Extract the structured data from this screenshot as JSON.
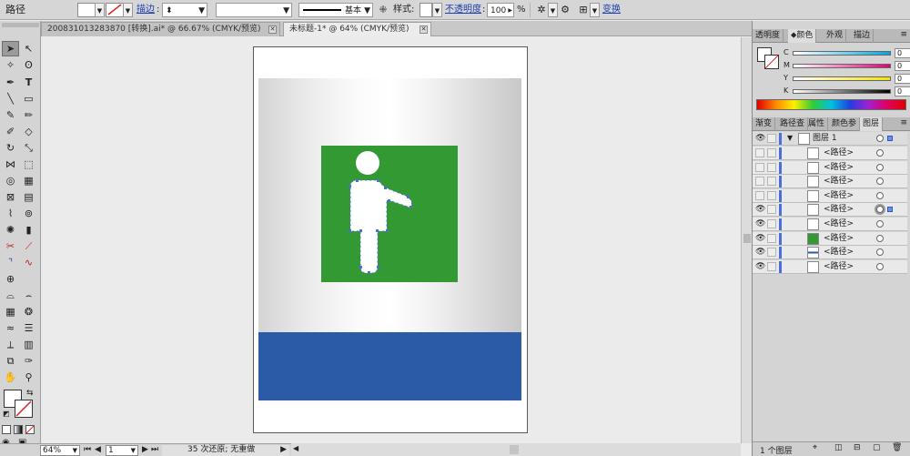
{
  "control_bar": {
    "object_type": "路径",
    "stroke_link": "描边",
    "stroke_profile": "基本",
    "style_label": "样式:",
    "opacity_link": "不透明度",
    "opacity_value": "100",
    "opacity_unit": "%",
    "transform_link": "变换"
  },
  "tabs": [
    {
      "label": "200831013283870 [转换].ai* @ 66.67% (CMYK/预览)"
    },
    {
      "label": "未标题-1* @ 64% (CMYK/预览)"
    }
  ],
  "artwork": {
    "green": "#339933",
    "blue": "#2b5aa6",
    "figure": "#ffffff",
    "selection": "#4a6fdc"
  },
  "status_bar": {
    "zoom": "64%",
    "artboard": "1",
    "history": "35 次还原; 无重做"
  },
  "color_panel": {
    "tabs": [
      "透明度",
      "颜色",
      "外观",
      "描边"
    ],
    "active_tab": "颜色",
    "channels": [
      {
        "label": "C",
        "value": "0",
        "color": "#00a6e0"
      },
      {
        "label": "M",
        "value": "0",
        "color": "#e2007a"
      },
      {
        "label": "Y",
        "value": "0",
        "color": "#f5e400"
      },
      {
        "label": "K",
        "value": "0",
        "color": "#000000"
      }
    ],
    "unit": "%"
  },
  "layers_panel": {
    "tabs": [
      "渐变",
      "路径查",
      "属性",
      "颜色参",
      "图层"
    ],
    "active_tab": "图层",
    "parent_layer": "图层 1",
    "items": [
      {
        "name": "<路径>",
        "visible": false,
        "thumb": "white"
      },
      {
        "name": "<路径>",
        "visible": false,
        "thumb": "white"
      },
      {
        "name": "<路径>",
        "visible": false,
        "thumb": "white"
      },
      {
        "name": "<路径>",
        "visible": false,
        "thumb": "white"
      },
      {
        "name": "<路径>",
        "visible": true,
        "thumb": "white",
        "selected": true
      },
      {
        "name": "<路径>",
        "visible": true,
        "thumb": "white"
      },
      {
        "name": "<路径>",
        "visible": true,
        "thumb": "green"
      },
      {
        "name": "<路径>",
        "visible": true,
        "thumb": "blue-band"
      },
      {
        "name": "<路径>",
        "visible": true,
        "thumb": "white"
      }
    ],
    "footer_count": "1 个图层"
  }
}
